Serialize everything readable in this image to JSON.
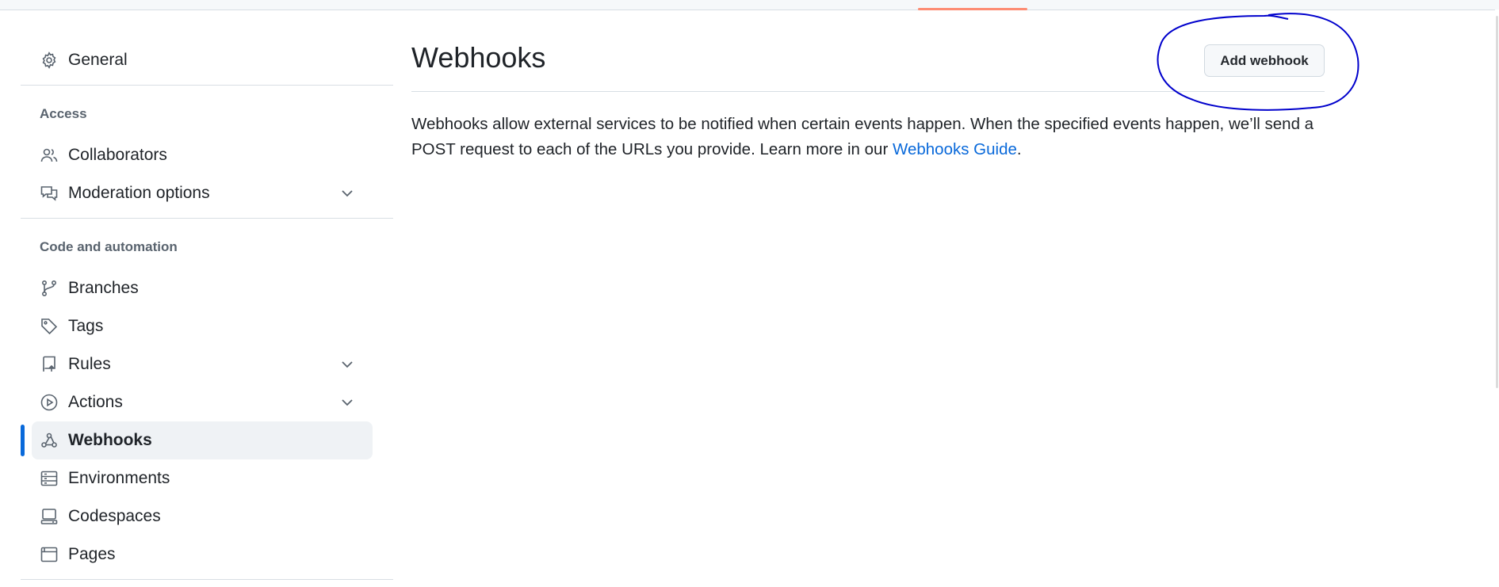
{
  "sidebar": {
    "general": {
      "label": "General",
      "icon": "gear-icon"
    },
    "access": {
      "title": "Access",
      "items": [
        {
          "label": "Collaborators",
          "icon": "people-icon"
        },
        {
          "label": "Moderation options",
          "icon": "comment-discussion-icon",
          "expandable": true
        }
      ]
    },
    "code_automation": {
      "title": "Code and automation",
      "items": [
        {
          "label": "Branches",
          "icon": "git-branch-icon"
        },
        {
          "label": "Tags",
          "icon": "tag-icon"
        },
        {
          "label": "Rules",
          "icon": "repo-push-icon",
          "expandable": true
        },
        {
          "label": "Actions",
          "icon": "play-icon",
          "expandable": true
        },
        {
          "label": "Webhooks",
          "icon": "webhook-icon",
          "active": true
        },
        {
          "label": "Environments",
          "icon": "server-icon"
        },
        {
          "label": "Codespaces",
          "icon": "codespaces-icon"
        },
        {
          "label": "Pages",
          "icon": "browser-icon"
        }
      ]
    }
  },
  "main": {
    "title": "Webhooks",
    "add_button": "Add webhook",
    "description_before": "Webhooks allow external services to be notified when certain events happen. When the specified events happen, we’ll send a POST request to each of the URLs you provide. Learn more in our ",
    "description_link": "Webhooks Guide",
    "description_after": "."
  },
  "colors": {
    "accent": "#0969da",
    "tab_underline": "#fd8c73",
    "annotation": "#0000cc"
  }
}
